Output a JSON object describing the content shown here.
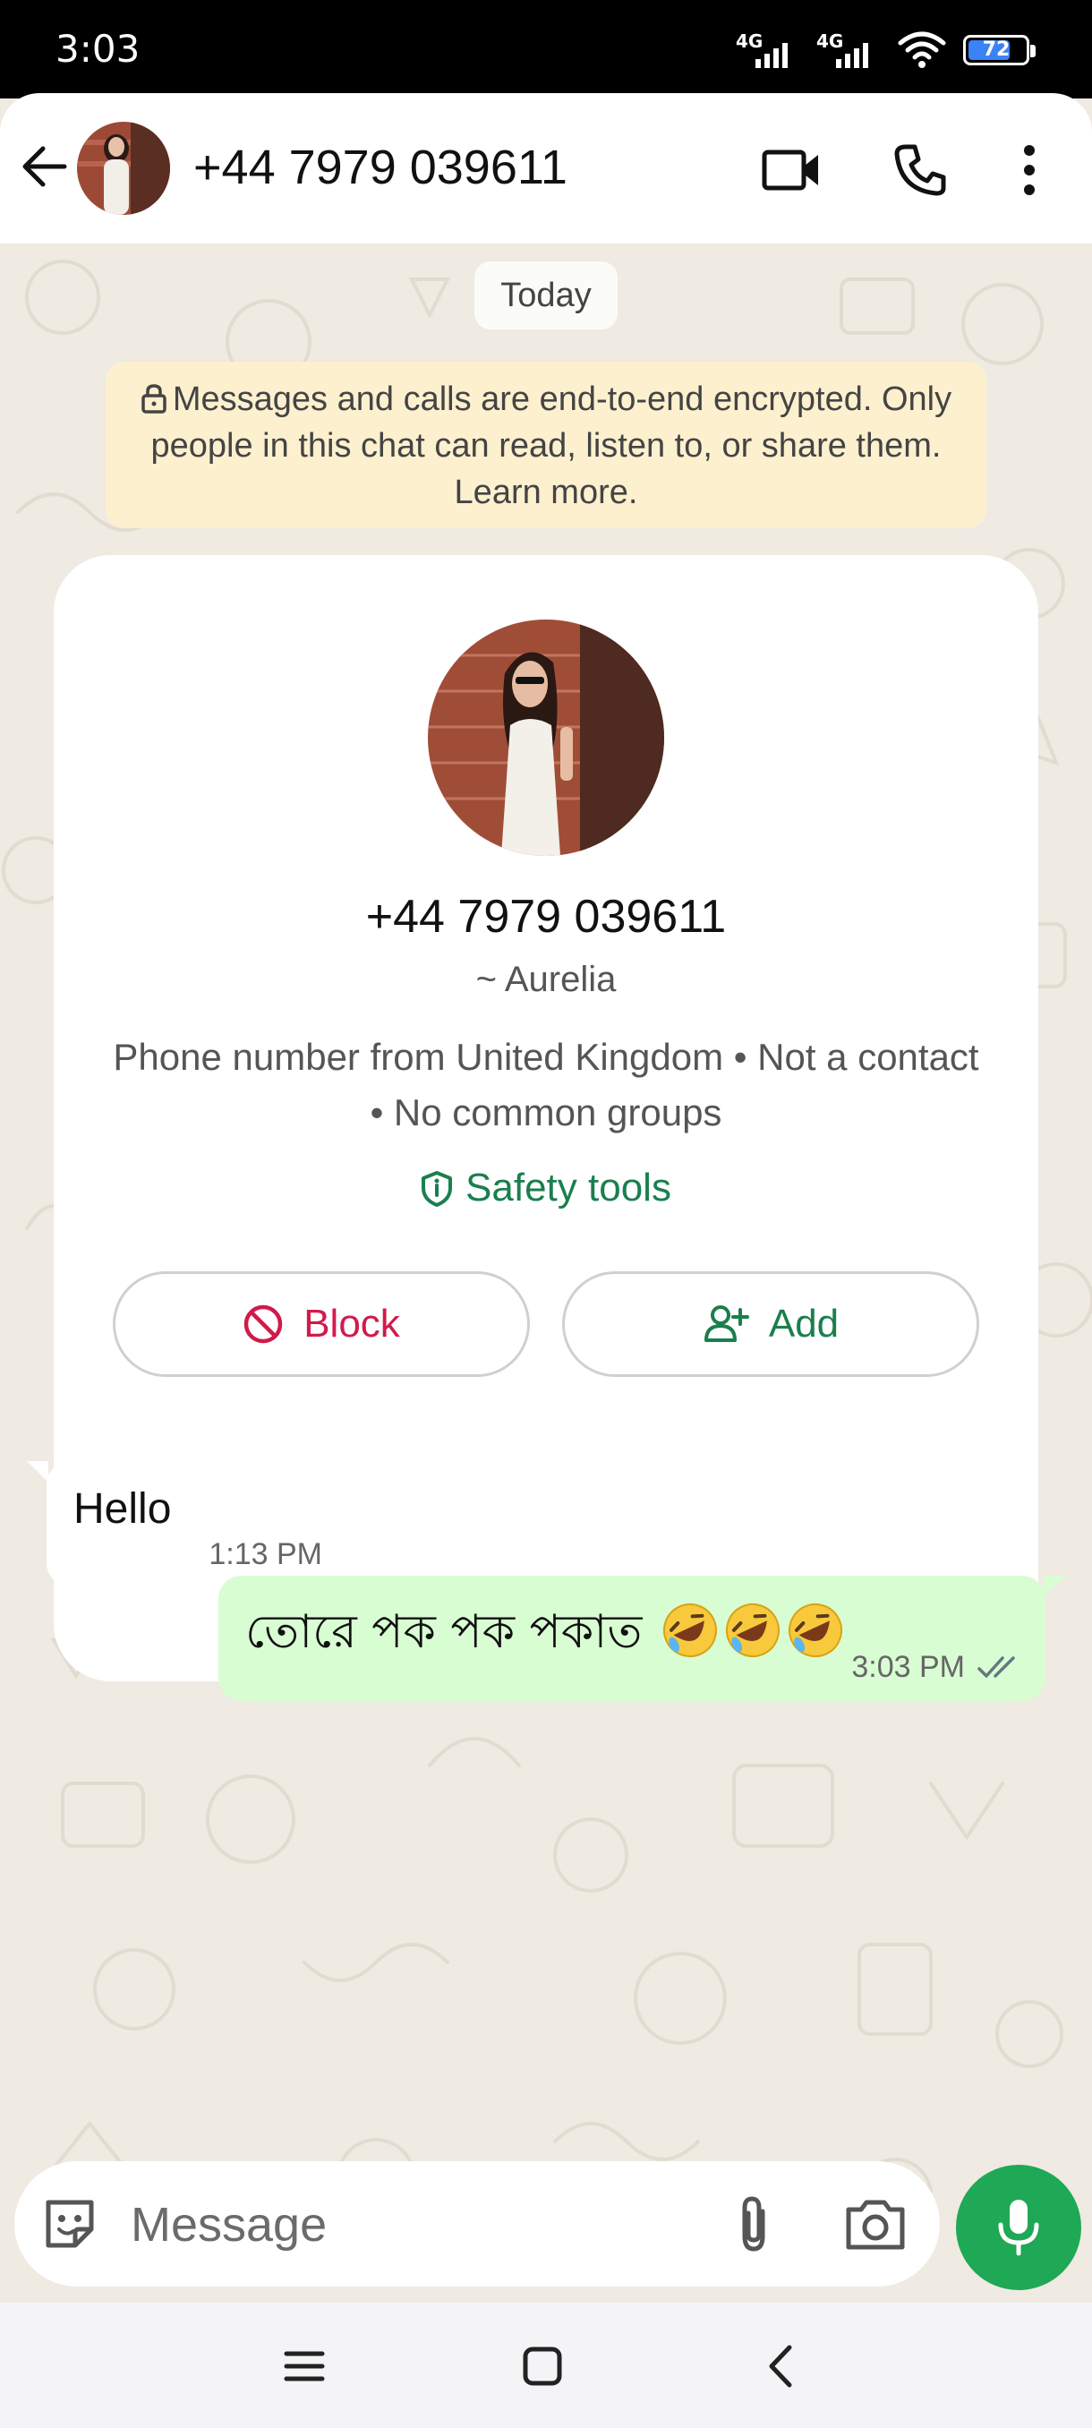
{
  "status_bar": {
    "time": "3:03",
    "network_1": "4G",
    "network_2": "4G",
    "battery": "72"
  },
  "header": {
    "title": "+44 7979 039611"
  },
  "chat": {
    "date_chip": "Today",
    "encryption_notice": "Messages and calls are end-to-end encrypted. Only people in this chat can read, listen to, or share them. Learn more.",
    "contact_card": {
      "phone": "+44 7979 039611",
      "name": "~ Aurelia",
      "info": "Phone number from United Kingdom  •  Not a contact  •  No common groups",
      "safety_tools": "Safety tools",
      "block_label": "Block",
      "add_label": "Add"
    },
    "messages": [
      {
        "direction": "incoming",
        "text": "Hello",
        "time": "1:13 PM"
      },
      {
        "direction": "outgoing",
        "text": "তোরে পক পক পকাত",
        "emoji": "rolling-on-floor-laughing x3",
        "time": "3:03 PM",
        "status": "read"
      }
    ]
  },
  "composer": {
    "placeholder": "Message"
  },
  "colors": {
    "accent_green": "#1fa855",
    "outgoing_bubble": "#d9fdd3",
    "block_red": "#d11a4a",
    "notice_yellow": "#fdf0cf"
  }
}
